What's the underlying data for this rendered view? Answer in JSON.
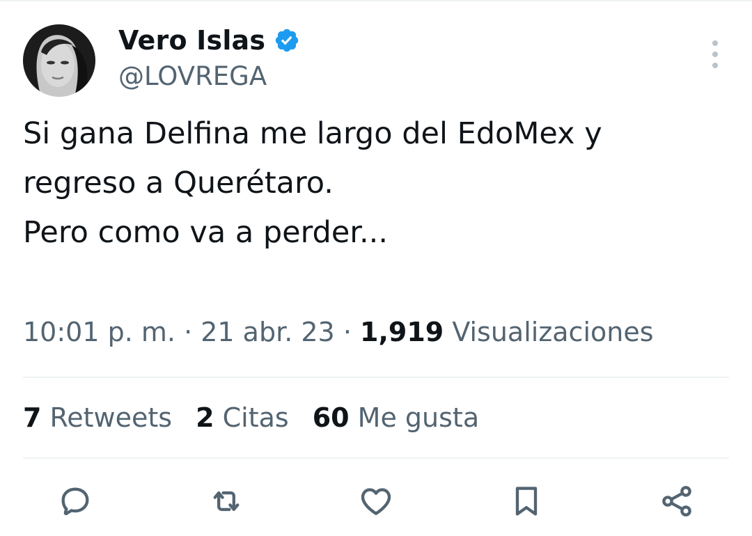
{
  "author": {
    "display_name": "Vero Islas",
    "handle": "@LOVREGA",
    "verified_icon": "verified-badge-icon",
    "avatar": "profile-photo"
  },
  "tweet": {
    "text_lines": [
      "Si gana Delfina me largo del EdoMex y",
      "regreso a Querétaro.",
      "",
      "Pero como va a perder..."
    ],
    "time": "10:01 p. m.",
    "separator": "·",
    "date": "21 abr. 23",
    "views_count": "1,919",
    "views_label": "Visualizaciones"
  },
  "stats": {
    "retweets_count": "7",
    "retweets_label": "Retweets",
    "quotes_count": "2",
    "quotes_label": "Citas",
    "likes_count": "60",
    "likes_label": "Me gusta"
  },
  "actions": [
    {
      "icon": "reply-icon"
    },
    {
      "icon": "retweet-icon"
    },
    {
      "icon": "like-icon"
    },
    {
      "icon": "bookmark-icon"
    },
    {
      "icon": "share-icon"
    }
  ],
  "colors": {
    "text_primary": "#0f1419",
    "text_secondary": "#536471",
    "verified_blue": "#1d9bf0",
    "divider": "#eff3f4",
    "icon_gray": "#536471"
  }
}
